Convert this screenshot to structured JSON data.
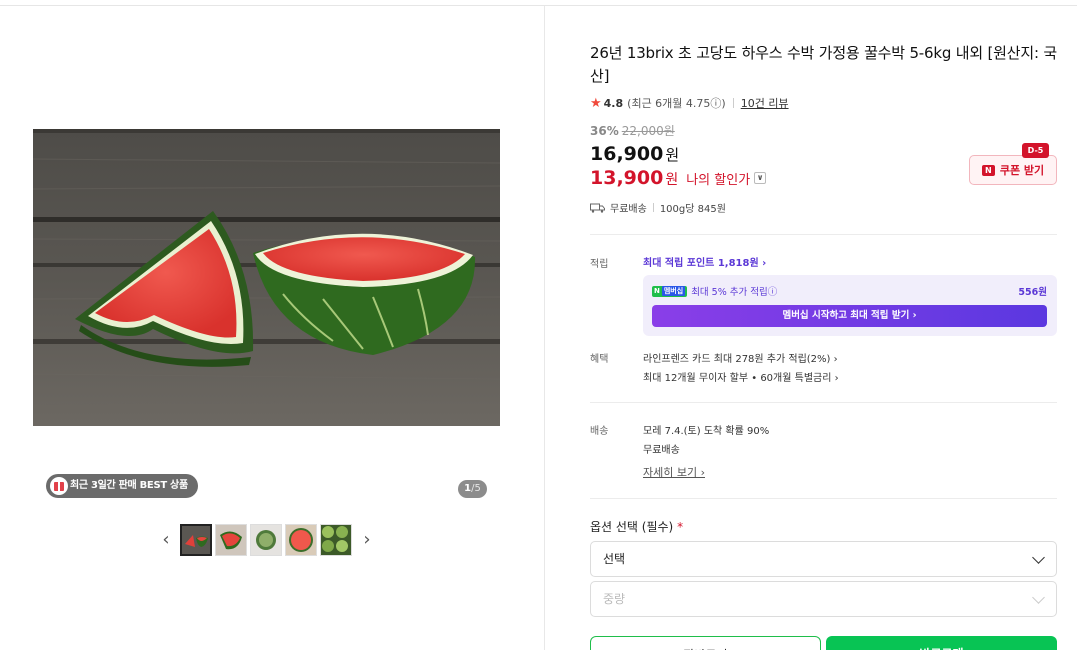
{
  "gallery": {
    "best_badge": "최근 3일간 판매 BEST 상품",
    "counter_current": "1",
    "counter_total": "/5",
    "prev_arrow": "‹",
    "next_arrow": "›",
    "thumbnail_count": 5
  },
  "product": {
    "title": "26년 13brix 초 고당도 하우스 수박 가정용 꿀수박 5-6kg 내외 [원산지: 국산]",
    "rating": {
      "star": "★",
      "score": "4.8",
      "recent": "(최근 6개월 4.75ⓘ)",
      "reviews": "10건 리뷰"
    },
    "discount_rate": "36%",
    "original_price": "22,000원",
    "price": "16,900",
    "price_unit": "원",
    "my_price": "13,900",
    "my_price_unit": "원",
    "my_price_label": "나의 할인가",
    "my_price_chevron": "∨",
    "coupon_dday": "D-5",
    "coupon_logo": "N",
    "coupon_label": "쿠폰 받기",
    "shipping": "무료배송",
    "unit_price": "100g당 845원"
  },
  "points": {
    "label": "적립",
    "max": "최대 적립 포인트 1,818원 ›",
    "membership_logo": "N",
    "membership_tag": "멤버십",
    "membership_text": "최대 5% 추가 적립ⓘ",
    "membership_value": "556원",
    "membership_button": "멤버십 시작하고 최대 적립 받기 ›"
  },
  "benefits": {
    "label": "혜택",
    "items": [
      "라인프렌즈 카드 최대 278원 추가 적립(2%) ›",
      "최대 12개월 무이자 할부 • 60개월 특별금리 ›"
    ]
  },
  "delivery": {
    "label": "배송",
    "arrival": "모레 7.4.(토) 도착 확률 90%",
    "fee": "무료배송",
    "more": "자세히 보기 ›"
  },
  "options": {
    "label": "옵션 선택 (필수)",
    "required_mark": "*",
    "select1": "선택",
    "select2": "중량"
  },
  "actions": {
    "cart": "장바구니",
    "buy": "바로구매"
  }
}
